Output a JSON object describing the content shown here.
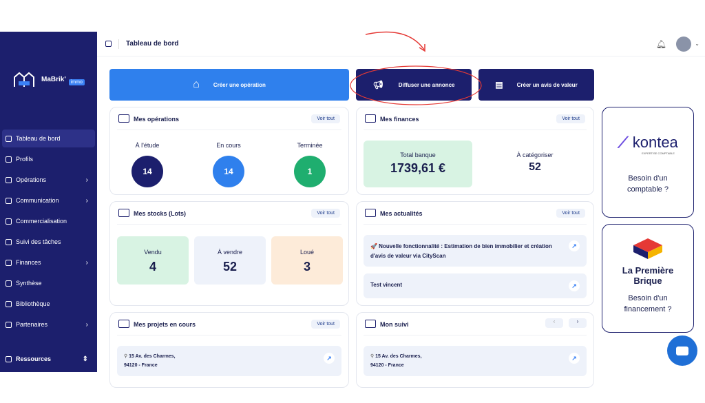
{
  "app": {
    "brand": "MaBrik'",
    "brand_badge": "immo"
  },
  "topbar": {
    "title": "Tableau de bord"
  },
  "sidebar": {
    "items": [
      {
        "label": "Tableau de bord",
        "active": true
      },
      {
        "label": "Profils"
      },
      {
        "label": "Opérations",
        "chevron": true
      },
      {
        "label": "Communication",
        "chevron": true
      },
      {
        "label": "Commercialisation"
      },
      {
        "label": "Suivi des tâches"
      },
      {
        "label": "Finances",
        "chevron": true
      },
      {
        "label": "Synthèse"
      },
      {
        "label": "Bibliothèque"
      },
      {
        "label": "Partenaires",
        "chevron": true
      }
    ],
    "footer": "Ressources"
  },
  "actions": {
    "create_op": "Créer une opération",
    "diffuse": "Diffuser une annonce",
    "avis": "Créer un avis de valeur"
  },
  "view_all": "Voir tout",
  "operations": {
    "title": "Mes opérations",
    "items": [
      {
        "label": "À l'étude",
        "value": "14",
        "color": "#1c1f6d"
      },
      {
        "label": "En cours",
        "value": "14",
        "color": "#2f80ed"
      },
      {
        "label": "Terminée",
        "value": "1",
        "color": "#1fae6f"
      }
    ]
  },
  "finances": {
    "title": "Mes finances",
    "total_label": "Total banque",
    "total_value": "1739,61 €",
    "cat_label": "À catégoriser",
    "cat_value": "52"
  },
  "stocks": {
    "title": "Mes stocks (Lots)",
    "items": [
      {
        "label": "Vendu",
        "value": "4",
        "color": "#d8f3e3"
      },
      {
        "label": "À vendre",
        "value": "52",
        "color": "#eef2fa"
      },
      {
        "label": "Loué",
        "value": "3",
        "color": "#fdebd9"
      }
    ]
  },
  "news": {
    "title": "Mes actualités",
    "items": [
      "🚀 Nouvelle fonctionnalité : Estimation de bien immobilier et création d'avis de valeur via CityScan",
      "Test vincent"
    ]
  },
  "projects": {
    "title": "Mes projets en cours",
    "addr1": "15 Av. des Charmes,",
    "addr2": "94120 - France"
  },
  "suivi": {
    "title": "Mon suivi",
    "addr1": "15 Av. des Charmes,",
    "addr2": "94120 - France"
  },
  "ads": {
    "kontea": "kontea",
    "kontea_sub": "EXPERTISE COMPTABLE",
    "kontea_text": "Besoin d'un comptable ?",
    "brique_line1": "La Première",
    "brique_line2": "Brique",
    "brique_text": "Besoin d'un financement ?"
  }
}
